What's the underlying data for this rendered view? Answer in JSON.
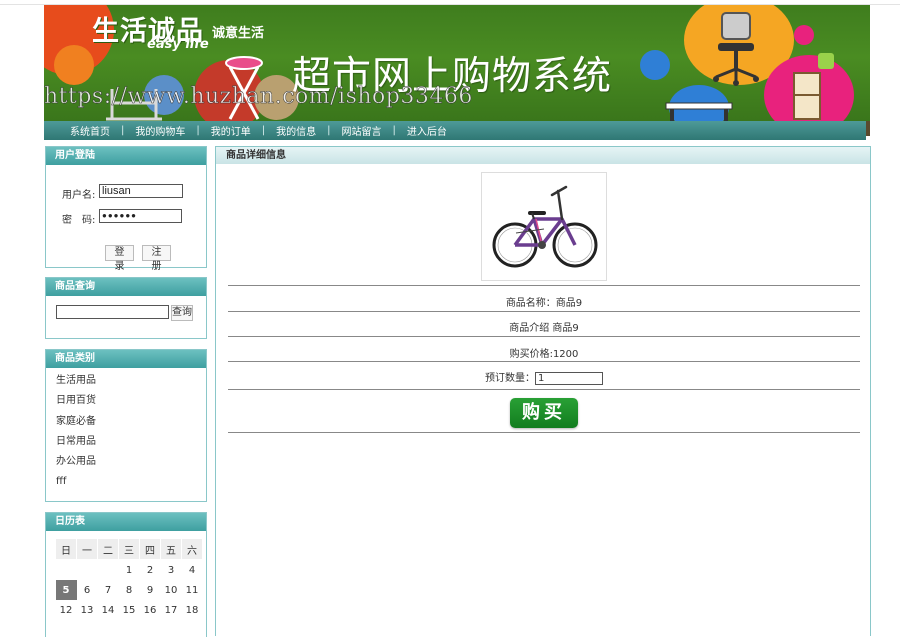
{
  "banner": {
    "brand_title": "生活诚品",
    "brand_subtitle": "诚意生活",
    "brand_en": "easy life",
    "system_title": "超市网上购物系统",
    "watermark": "https://www.huzhan.com/ishop33466"
  },
  "nav": {
    "items": [
      {
        "label": "系统首页"
      },
      {
        "label": "我的购物车"
      },
      {
        "label": "我的订单"
      },
      {
        "label": "我的信息"
      },
      {
        "label": "网站留言"
      },
      {
        "label": "进入后台"
      }
    ],
    "separator": "|"
  },
  "login": {
    "title": "用户登陆",
    "username_label": "用户名:",
    "username_value": "liusan",
    "password_label": "密　码:",
    "password_value": "●●●●●●",
    "login_label": "登 录",
    "register_label": "注 册"
  },
  "search": {
    "title": "商品查询",
    "input_value": "",
    "button_label": "查询"
  },
  "categories": {
    "title": "商品类别",
    "items": [
      "生活用品",
      "日用百货",
      "家庭必备",
      "日常用品",
      "办公用品",
      "fff"
    ]
  },
  "calendar": {
    "title": "日历表",
    "weekdays": [
      "日",
      "一",
      "二",
      "三",
      "四",
      "五",
      "六"
    ],
    "row1": [
      "",
      "",
      "",
      "1",
      "2",
      "3",
      "4"
    ],
    "row2": [
      "5",
      "6",
      "7",
      "8",
      "9",
      "10",
      "11"
    ],
    "row3": [
      "12",
      "13",
      "14",
      "15",
      "16",
      "17",
      "18"
    ],
    "today": "5"
  },
  "product": {
    "section_title": "商品详细信息",
    "name_line": "商品名称：商品9",
    "intro_line": "商品介绍 商品9",
    "price_line": "购买价格:1200",
    "qty_label": "预订数量：",
    "qty_value": "1",
    "buy_label": "购买"
  },
  "colors": {
    "header_green": "#4a8c22",
    "nav_teal": "#2f7774",
    "box_border": "#8ac7c9",
    "buy_green": "#127d1f"
  }
}
